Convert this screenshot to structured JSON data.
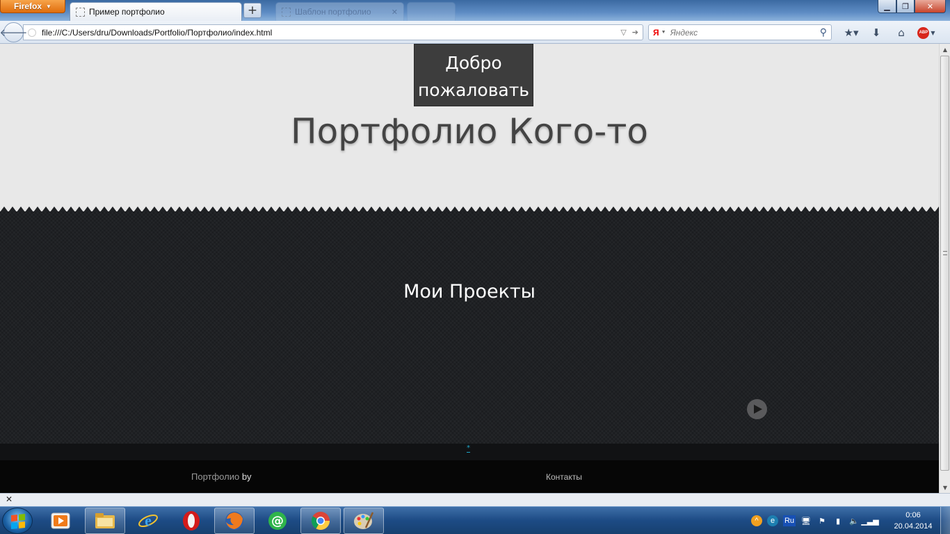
{
  "browser": {
    "menu_button": "Firefox",
    "active_tab_title": "Пример портфолио",
    "background_tab_title": "Шаблон портфолио",
    "url": "file:///C:/Users/dru/Downloads/Portfolio/Портфолио/index.html",
    "search_engine": "Я",
    "search_placeholder": "Яндекс",
    "abp_label": "ABP"
  },
  "page": {
    "welcome_text": "Добро пожаловать",
    "hero_title": "Портфолио Кого-то",
    "projects_title": "Мои Проекты",
    "footer_star": "*",
    "footer_brand": "Портфолио",
    "footer_by": "by",
    "footer_contacts": "Контакты"
  },
  "taskbar": {
    "apps": [
      "media-player",
      "explorer",
      "internet-explorer",
      "opera",
      "firefox",
      "mail-agent",
      "chrome",
      "paint"
    ],
    "tray_lang": "Ru",
    "clock_time": "0:06",
    "clock_date": "20.04.2014"
  },
  "colors": {
    "hero_bg": "#e8e8e8",
    "projects_bg": "#1f2124",
    "footer_bg": "#060606",
    "accent": "#1ea6c8"
  }
}
